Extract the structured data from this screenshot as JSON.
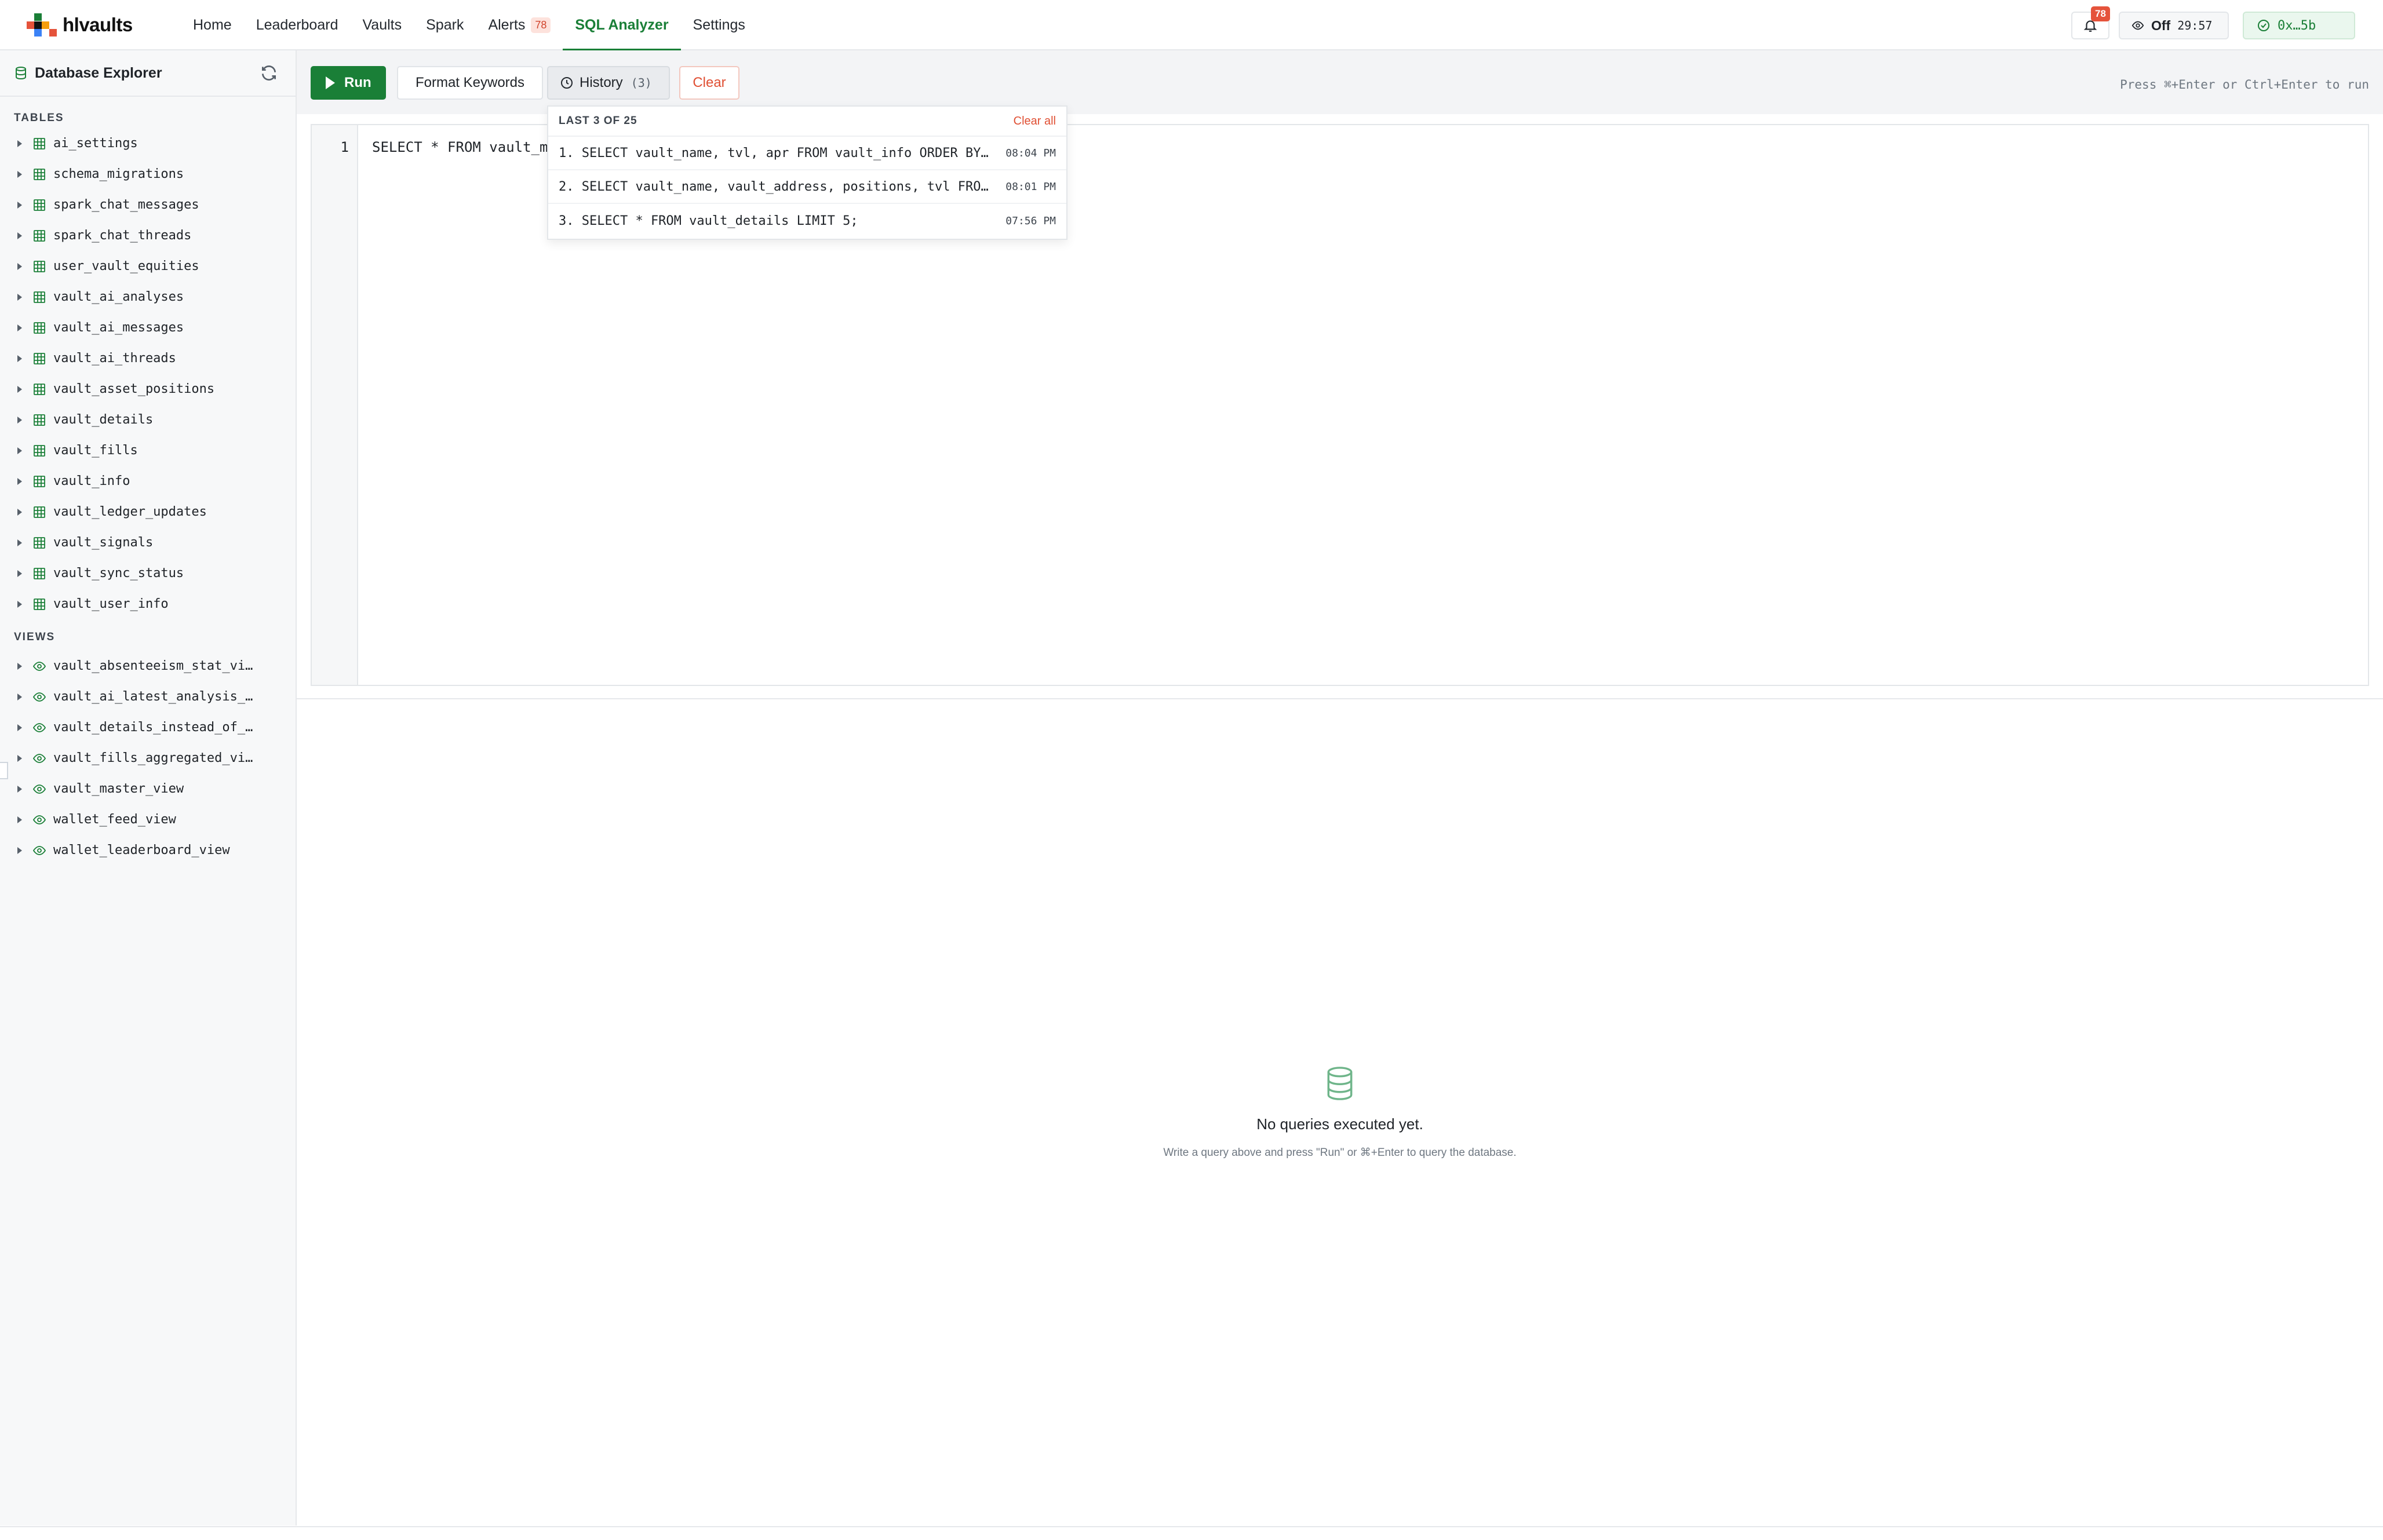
{
  "app": {
    "brand": "hlvaults"
  },
  "nav": {
    "links": [
      {
        "label": "Home"
      },
      {
        "label": "Leaderboard"
      },
      {
        "label": "Vaults"
      },
      {
        "label": "Spark"
      },
      {
        "label": "Alerts",
        "badge": "78"
      },
      {
        "label": "SQL Analyzer",
        "active": true
      },
      {
        "label": "Settings"
      }
    ],
    "notifications_count": "78",
    "watch": {
      "state": "Off",
      "timer": "29:57"
    },
    "wallet": {
      "address": "0x…5b"
    }
  },
  "sidebar": {
    "title": "Database Explorer",
    "tables_heading": "TABLES",
    "tables": [
      "ai_settings",
      "schema_migrations",
      "spark_chat_messages",
      "spark_chat_threads",
      "user_vault_equities",
      "vault_ai_analyses",
      "vault_ai_messages",
      "vault_ai_threads",
      "vault_asset_positions",
      "vault_details",
      "vault_fills",
      "vault_info",
      "vault_ledger_updates",
      "vault_signals",
      "vault_sync_status",
      "vault_user_info"
    ],
    "views_heading": "VIEWS",
    "views": [
      "vault_absenteeism_stat_vi…",
      "vault_ai_latest_analysis_…",
      "vault_details_instead_of_…",
      "vault_fills_aggregated_vi…",
      "vault_master_view",
      "wallet_feed_view",
      "wallet_leaderboard_view"
    ]
  },
  "toolbar": {
    "run_label": "Run",
    "format_label": "Format Keywords",
    "history_label": "History",
    "history_count": "(3)",
    "clear_label": "Clear",
    "hint": "Press ⌘+Enter or Ctrl+Enter to run"
  },
  "editor": {
    "line_number": "1",
    "code": "SELECT * FROM vault_m"
  },
  "history_dropdown": {
    "title": "LAST 3 OF 25",
    "clear_all": "Clear all",
    "items": [
      {
        "query": "1. SELECT vault_name, tvl, apr FROM vault_info ORDER BY…",
        "time": "08:04 PM"
      },
      {
        "query": "2. SELECT vault_name, vault_address, positions, tvl FRO…",
        "time": "08:01 PM"
      },
      {
        "query": "3. SELECT * FROM vault_details LIMIT 5;",
        "time": "07:56 PM"
      }
    ]
  },
  "results": {
    "empty_title": "No queries executed yet.",
    "empty_subtitle": "Write a query above and press \"Run\" or ⌘+Enter to query the database."
  },
  "colors": {
    "accent": "#1a7f37",
    "danger": "#e04f33",
    "badge": "#e5533b"
  }
}
